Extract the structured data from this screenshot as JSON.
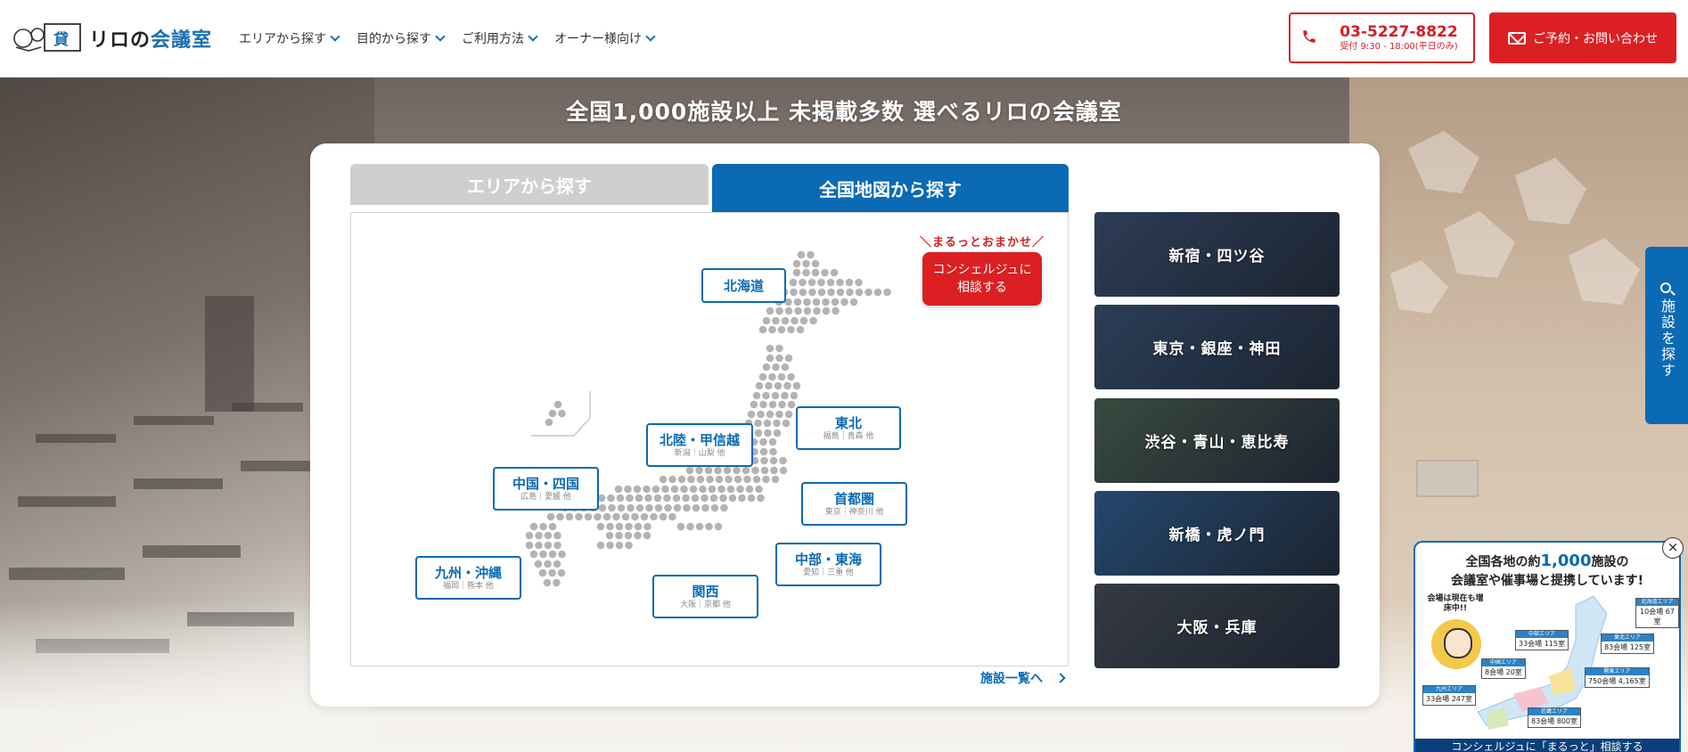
{
  "header": {
    "logo_text": "リロの",
    "logo_accent": "会議室",
    "logo_kanji": "貸",
    "nav": [
      {
        "label": "エリアから探す"
      },
      {
        "label": "目的から探す"
      },
      {
        "label": "ご利用方法"
      },
      {
        "label": "オーナー様向け"
      }
    ],
    "tel": {
      "number": "03-5227-8822",
      "hours": "受付 9:30 - 18:00(平日のみ)"
    },
    "contact_label": "ご予約・お問い合わせ"
  },
  "hero": {
    "title": "全国1,000施設以上 未掲載多数 選べるリロの会議室"
  },
  "tabs": {
    "area": "エリアから探す",
    "map": "全国地図から探す"
  },
  "map": {
    "regions": [
      {
        "id": "hokkaido",
        "name": "北海道",
        "sub": ""
      },
      {
        "id": "tohoku",
        "name": "東北",
        "sub": "福島｜青森 他"
      },
      {
        "id": "hokuriku",
        "name": "北陸・甲信越",
        "sub": "新潟｜山梨 他"
      },
      {
        "id": "shutoken",
        "name": "首都圏",
        "sub": "東京｜神奈川 他"
      },
      {
        "id": "chugoku",
        "name": "中国・四国",
        "sub": "広島｜愛媛 他"
      },
      {
        "id": "chubu",
        "name": "中部・東海",
        "sub": "愛知｜三重 他"
      },
      {
        "id": "kyushu",
        "name": "九州・沖縄",
        "sub": "福岡｜熊本 他"
      },
      {
        "id": "kansai",
        "name": "関西",
        "sub": "大阪｜京都 他"
      }
    ],
    "concierge_caption": "＼まるっとおまかせ／",
    "concierge_line1": "コンシェルジュに",
    "concierge_line2": "相談する",
    "facility_link": "施設一覧へ"
  },
  "areas": [
    {
      "label": "新宿・四ツ谷",
      "color": "#2d3d56"
    },
    {
      "label": "東京・銀座・神田",
      "color": "#2b3e58"
    },
    {
      "label": "渋谷・青山・恵比寿",
      "color": "#3a4a3f"
    },
    {
      "label": "新橋・虎ノ門",
      "color": "#24476e"
    },
    {
      "label": "大阪・兵庫",
      "color": "#353a42"
    }
  ],
  "side_tab": {
    "label": "施設を探す"
  },
  "popup": {
    "head1_pre": "全国各地の約",
    "head1_big": "1,000",
    "head1_post": "施設の",
    "head2": "会議室や催事場と提携しています!",
    "bubble": "会場は現在も増床中!!",
    "tags": [
      {
        "label": "北海道エリア",
        "value": "10会場 67室"
      },
      {
        "label": "中部エリア",
        "value": "33会場 115室"
      },
      {
        "label": "東北エリア",
        "value": "83会場 125室"
      },
      {
        "label": "中国エリア",
        "value": "8会場 20室"
      },
      {
        "label": "関東エリア",
        "value": "750会場 4,165室"
      },
      {
        "label": "九州エリア",
        "value": "33会場 247室"
      },
      {
        "label": "近畿エリア",
        "value": "83会場 800室"
      }
    ],
    "footer": "コンシェルジュに「まるっと」相談する"
  }
}
